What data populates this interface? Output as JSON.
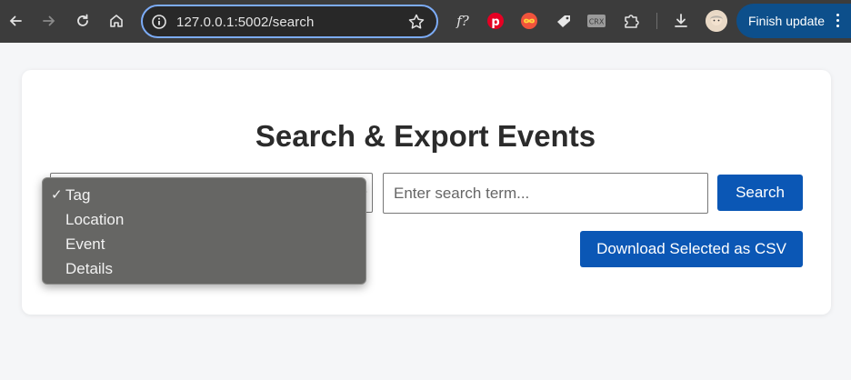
{
  "browser": {
    "url": "127.0.0.1:5002/search",
    "finish_update_label": "Finish update",
    "extensions": [
      "fx-icon",
      "pinterest-icon",
      "infinity-icon",
      "tag-extension-icon",
      "crx-icon",
      "puzzle-icon"
    ],
    "crx_label": "CRX"
  },
  "page": {
    "title": "Search & Export Events",
    "search_placeholder": "Enter search term...",
    "search_button": "Search",
    "download_button": "Download Selected as CSV"
  },
  "dropdown": {
    "check": "✓",
    "options": [
      "Tag",
      "Location",
      "Event",
      "Details"
    ],
    "selected": "Tag"
  },
  "colors": {
    "accent": "#0b57b5",
    "toolbar": "#3c3c3c",
    "omnibox_border": "#7cacf8",
    "update_pill": "#0d4f8b"
  }
}
